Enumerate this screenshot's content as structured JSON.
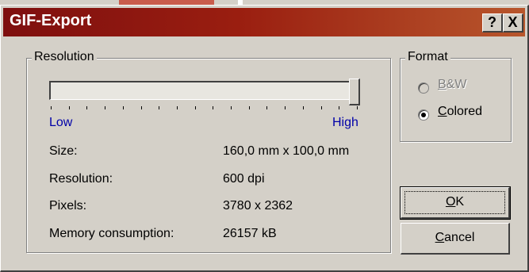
{
  "window": {
    "title": "GIF-Export",
    "help_button": "?",
    "close_button": "X"
  },
  "resolution_group": {
    "title": "Resolution",
    "slider": {
      "value_fraction": 1.0,
      "min_label": "Low",
      "max_label": "High",
      "tick_count": 18
    },
    "rows": [
      {
        "label": "Size:",
        "value": "160,0 mm x 100,0 mm"
      },
      {
        "label": "Resolution:",
        "value": "600 dpi"
      },
      {
        "label": "Pixels:",
        "value": "3780 x 2362"
      },
      {
        "label": "Memory consumption:",
        "value": "26157 kB"
      }
    ]
  },
  "format_group": {
    "title": "Format",
    "options": [
      {
        "mnemonic": "B",
        "rest": "&W",
        "checked": false,
        "disabled": true
      },
      {
        "mnemonic": "C",
        "rest": "olored",
        "checked": true,
        "disabled": false
      }
    ]
  },
  "buttons": {
    "ok": {
      "mnemonic": "O",
      "rest": "K"
    },
    "cancel": {
      "mnemonic": "C",
      "rest": "ancel"
    }
  },
  "colors": {
    "title_gradient_start": "#7e0f0f",
    "title_gradient_end": "#b8562c",
    "face": "#d4d0c8",
    "label_blue": "#0000a8"
  }
}
